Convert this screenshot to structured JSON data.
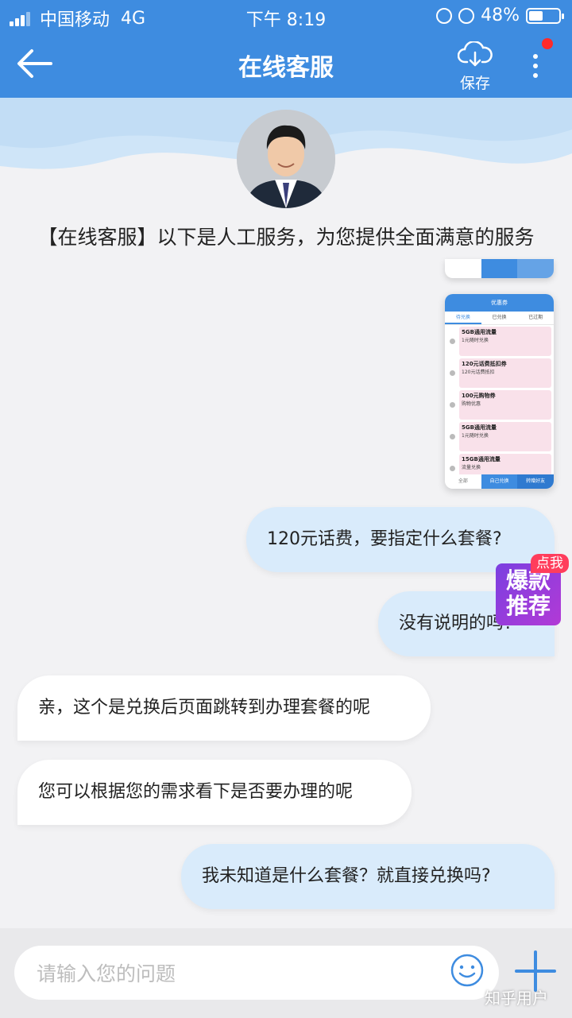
{
  "status_bar": {
    "carrier": "中国移动",
    "network": "4G",
    "time": "下午 8:19",
    "battery": "48%",
    "battery_level": 0.48
  },
  "nav": {
    "title": "在线客服",
    "save_label": "保存",
    "back_icon": "arrow-left-icon",
    "save_icon": "cloud-download-icon",
    "more_icon": "more-vertical-icon"
  },
  "header": {
    "service_line": "【在线客服】以下是人工服务，为您提供全面满意的服务"
  },
  "thumbnail": {
    "title": "优惠券",
    "tabs": [
      "待兑换",
      "已兑换",
      "已过期"
    ],
    "items": [
      {
        "name": "5GB通用流量",
        "desc": "1元随时兑换"
      },
      {
        "name": "120元话费抵扣券",
        "desc": "120元话费抵扣"
      },
      {
        "name": "100元购物券",
        "desc": "购物优惠"
      },
      {
        "name": "5GB通用流量",
        "desc": "1元随时兑换"
      },
      {
        "name": "15GB通用流量",
        "desc": "流量兑换"
      }
    ],
    "footer": [
      "全部",
      "自己兑换",
      "转赠好友"
    ]
  },
  "messages": [
    {
      "side": "out",
      "text": "120元话费，要指定什么套餐?"
    },
    {
      "side": "out",
      "text": "没有说明的吗?"
    },
    {
      "side": "in",
      "text": "亲，这个是兑换后页面跳转到办理套餐的呢"
    },
    {
      "side": "in",
      "text": "您可以根据您的需求看下是否要办理的呢"
    },
    {
      "side": "out",
      "text": "我未知道是什么套餐？就直接兑换吗?"
    }
  ],
  "promo": {
    "tag": "点我",
    "line1": "爆款",
    "line2": "推荐"
  },
  "input": {
    "placeholder": "请输入您的问题",
    "value": ""
  },
  "watermark": "知乎用户",
  "colors": {
    "brand": "#3e8ce0",
    "outgoing_bubble": "#d9ebfb",
    "incoming_bubble": "#ffffff",
    "notification_dot": "#ff2a2a"
  }
}
